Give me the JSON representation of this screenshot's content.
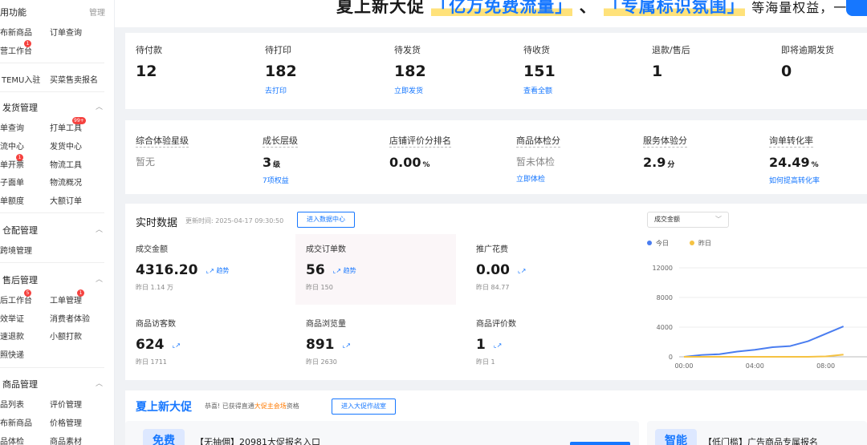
{
  "sidebar": {
    "header": "用功能",
    "manage": "管理",
    "items_top": [
      "布新商品",
      "订单查询",
      "营工作台"
    ],
    "temu": [
      "TEMU入驻",
      "买菜售卖报名"
    ],
    "shipping": {
      "title": "发货管理",
      "items": [
        "单查询",
        "打单工具",
        "流中心",
        "发货中心",
        "单开票",
        "物流工具",
        "子面单",
        "物流概况",
        "单额度",
        "大额订单"
      ],
      "badge": "99+"
    },
    "warehouse": {
      "title": "仓配管理",
      "items": [
        "跨境管理"
      ]
    },
    "aftersale": {
      "title": "售后管理",
      "items": [
        "后工作台",
        "工单管理",
        "效举证",
        "消费者体验",
        "速退款",
        "小额打款",
        "照快递"
      ]
    },
    "product": {
      "title": "商品管理",
      "items": [
        "品列表",
        "评价管理",
        "布新商品",
        "价格管理",
        "品体检",
        "商品素材"
      ]
    }
  },
  "banner": {
    "text_start": "夏上新大促",
    "q1": "「亿万免费流量」",
    "sep": "、",
    "q2": "「专属标识氛围」",
    "text_end": "等海量权益，一步即享！"
  },
  "orders": [
    {
      "label": "待付款",
      "value": "12",
      "link": ""
    },
    {
      "label": "待打印",
      "value": "182",
      "link": "去打印"
    },
    {
      "label": "待发货",
      "value": "182",
      "link": "立即发货"
    },
    {
      "label": "待收货",
      "value": "151",
      "link": "查看全额"
    },
    {
      "label": "退款/售后",
      "value": "1",
      "link": ""
    },
    {
      "label": "即将逾期发货",
      "value": "0",
      "link": ""
    }
  ],
  "experience": [
    {
      "label": "综合体验星级",
      "value": "暂无",
      "unit": "",
      "link": ""
    },
    {
      "label": "成长层级",
      "value": "3",
      "unit": "级",
      "link": "7项权益"
    },
    {
      "label": "店铺评价分排名",
      "value": "0.00",
      "unit": "%",
      "link": ""
    },
    {
      "label": "商品体检分",
      "value": "暂未体检",
      "unit": "",
      "link": "立即体检"
    },
    {
      "label": "服务体验分",
      "value": "2.9",
      "unit": "分",
      "link": ""
    },
    {
      "label": "询单转化率",
      "value": "24.49",
      "unit": "%",
      "link": "如何提高转化率"
    }
  ],
  "realtime": {
    "title": "实时数据",
    "update_time": "更新时间: 2025-04-17 09:30:50",
    "button": "进入数据中心",
    "metrics": [
      {
        "label": "成交金额",
        "value": "4316.20",
        "trend": "趋势",
        "yesterday": "昨日 1.14 万"
      },
      {
        "label": "成交订单数",
        "value": "56",
        "trend": "趋势",
        "yesterday": "昨日 150"
      },
      {
        "label": "推广花费",
        "value": "0.00",
        "trend": "",
        "yesterday": "昨日 84.77"
      },
      {
        "label": "商品访客数",
        "value": "624",
        "trend": "",
        "yesterday": "昨日 1711"
      },
      {
        "label": "商品浏览量",
        "value": "891",
        "trend": "",
        "yesterday": "昨日 2630"
      },
      {
        "label": "商品评价数",
        "value": "1",
        "trend": "",
        "yesterday": "昨日 1"
      }
    ],
    "chart_select": "成交金额"
  },
  "chart_data": {
    "type": "line",
    "x": [
      "00:00",
      "01:00",
      "02:00",
      "03:00",
      "04:00",
      "05:00",
      "06:00",
      "07:00",
      "08:00",
      "09:00"
    ],
    "series": [
      {
        "name": "今日",
        "color": "#4a7df0",
        "values": [
          0,
          250,
          350,
          700,
          950,
          1300,
          1450,
          2100,
          3100,
          4100
        ]
      },
      {
        "name": "昨日",
        "color": "#f5c242",
        "values": [
          0,
          0,
          0,
          0,
          0,
          0,
          0,
          0,
          50,
          300
        ]
      }
    ],
    "x_ticks": [
      "00:00",
      "04:00",
      "08:00"
    ],
    "y_ticks": [
      0,
      4000,
      8000,
      12000
    ],
    "ylim": [
      0,
      12000
    ],
    "legend": "top-left"
  },
  "promo": {
    "title": "夏上新大促",
    "msg_start": "恭喜! 已获得直通",
    "msg_highlight": "大促主会场",
    "msg_end": "资格",
    "button": "进入大促作战室",
    "sub1_tag": "免费",
    "sub1_text": "【无抽佣】20981大促报名入口",
    "sub2_tag": "智能",
    "sub2_text": "【低门槛】广告商品专属报名"
  },
  "colors": {
    "accent": "#1677ff",
    "badge": "#f5423f",
    "highlight": "#ffe27a"
  }
}
